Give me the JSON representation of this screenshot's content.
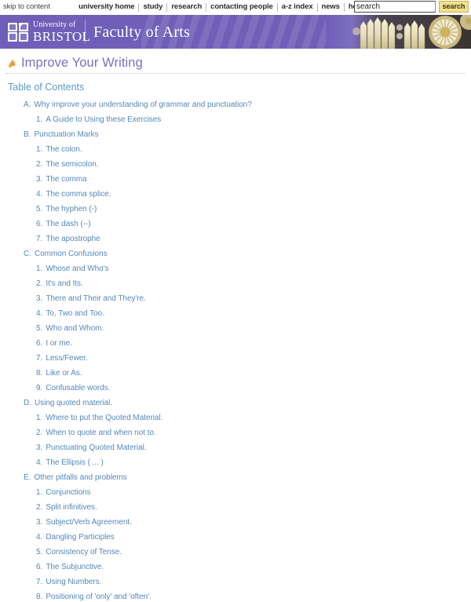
{
  "utility": {
    "skip_label": "skip to content",
    "nav": [
      "university home",
      "study",
      "research",
      "contacting people",
      "a-z index",
      "news",
      "help"
    ],
    "search": {
      "value": "search",
      "placeholder": "search",
      "button_label": "search"
    }
  },
  "masthead": {
    "crest_alt": "university-crest",
    "university_line1": "University of",
    "university_line2": "BRISTOL",
    "faculty": "Faculty of Arts"
  },
  "page": {
    "title": "Improve Your Writing",
    "title_icon": "leaf-icon",
    "section_heading": "Table of Contents"
  },
  "colors": {
    "masthead_purple": "#6f5fb8",
    "title_purple": "#7a6fc0",
    "link_blue": "#5588bb",
    "heading_blue": "#5d9bc4",
    "search_button": "#f0e08c"
  },
  "toc": [
    {
      "marker": "A.",
      "label": "Why improve your understanding of grammar and punctuation?",
      "items": [
        {
          "marker": "1.",
          "label": "A Guide to Using these Exercises"
        }
      ]
    },
    {
      "marker": "B.",
      "label": "Punctuation Marks",
      "items": [
        {
          "marker": "1.",
          "label": "The colon."
        },
        {
          "marker": "2.",
          "label": "The semicolon."
        },
        {
          "marker": "3.",
          "label": "The comma"
        },
        {
          "marker": "4.",
          "label": "The comma splice."
        },
        {
          "marker": "5.",
          "label": "The hyphen (-)"
        },
        {
          "marker": "6.",
          "label": "The dash (--)"
        },
        {
          "marker": "7.",
          "label": "The apostrophe"
        }
      ]
    },
    {
      "marker": "C.",
      "label": "Common Confusions",
      "items": [
        {
          "marker": "1.",
          "label": "Whose and Who's"
        },
        {
          "marker": "2.",
          "label": "It's and Its."
        },
        {
          "marker": "3.",
          "label": "There and Their and They're."
        },
        {
          "marker": "4.",
          "label": "To, Two and Too."
        },
        {
          "marker": "5.",
          "label": "Who and Whom."
        },
        {
          "marker": "6.",
          "label": "I or me."
        },
        {
          "marker": "7.",
          "label": "Less/Fewer."
        },
        {
          "marker": "8.",
          "label": "Like or As."
        },
        {
          "marker": "9.",
          "label": "Confusable words."
        }
      ]
    },
    {
      "marker": "D.",
      "label": "Using quoted material.",
      "items": [
        {
          "marker": "1.",
          "label": "Where to put the Quoted Material."
        },
        {
          "marker": "2.",
          "label": "When to quote and when not to."
        },
        {
          "marker": "3.",
          "label": "Punctuating Quoted Material."
        },
        {
          "marker": "4.",
          "label": "The Ellipsis ( ... )"
        }
      ]
    },
    {
      "marker": "E.",
      "label": "Other pitfalls and problems",
      "items": [
        {
          "marker": "1.",
          "label": "Conjunctions"
        },
        {
          "marker": "2.",
          "label": "Split infinitives."
        },
        {
          "marker": "3.",
          "label": "Subject/Verb Agreement."
        },
        {
          "marker": "4.",
          "label": "Dangling Participles"
        },
        {
          "marker": "5.",
          "label": "Consistency of Tense."
        },
        {
          "marker": "6.",
          "label": "The Subjunctive."
        },
        {
          "marker": "7.",
          "label": "Using Numbers."
        },
        {
          "marker": "8.",
          "label": "Positioning of 'only' and 'often'."
        }
      ]
    }
  ]
}
